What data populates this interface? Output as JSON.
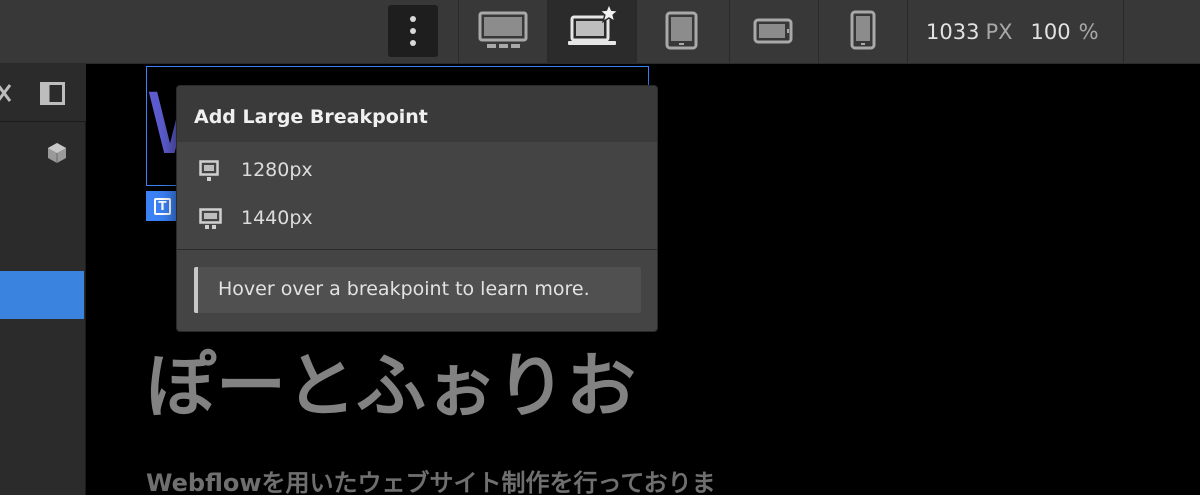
{
  "toolbar": {
    "more_icon": "more-vertical-icon",
    "breakpoints": [
      {
        "name": "desktop-base",
        "icon": "desktop-icon",
        "active": false
      },
      {
        "name": "desktop-large",
        "icon": "laptop-star-icon",
        "active": true
      },
      {
        "name": "tablet",
        "icon": "tablet-icon",
        "active": false
      },
      {
        "name": "mobile-landscape",
        "icon": "phone-landscape-icon",
        "active": false
      },
      {
        "name": "mobile-portrait",
        "icon": "phone-portrait-icon",
        "active": false
      }
    ],
    "width_value": "1033",
    "width_unit": "PX",
    "zoom_value": "100",
    "zoom_unit": "%"
  },
  "left_panel": {
    "close_icon": "close-icon",
    "dock_icon": "panel-dock-icon",
    "component_icon": "cube-icon"
  },
  "canvas": {
    "selected_heading_partial": "W",
    "selected_element_icon": "text-element-icon",
    "hero_title": "ぽーとふぉりお",
    "hero_subtitle": "Webflowを用いたウェブサイト制作を行っておりま"
  },
  "popover": {
    "title": "Add Large Breakpoint",
    "options": [
      {
        "label": "1280px",
        "icon": "monitor-icon"
      },
      {
        "label": "1440px",
        "icon": "monitor-wide-icon"
      }
    ],
    "hint": "Hover over a breakpoint to learn more."
  },
  "colors": {
    "accent": "#3b82f6",
    "selection_row": "#3a84df",
    "toolbar_bg": "#383838",
    "popover_bg": "#444444"
  }
}
